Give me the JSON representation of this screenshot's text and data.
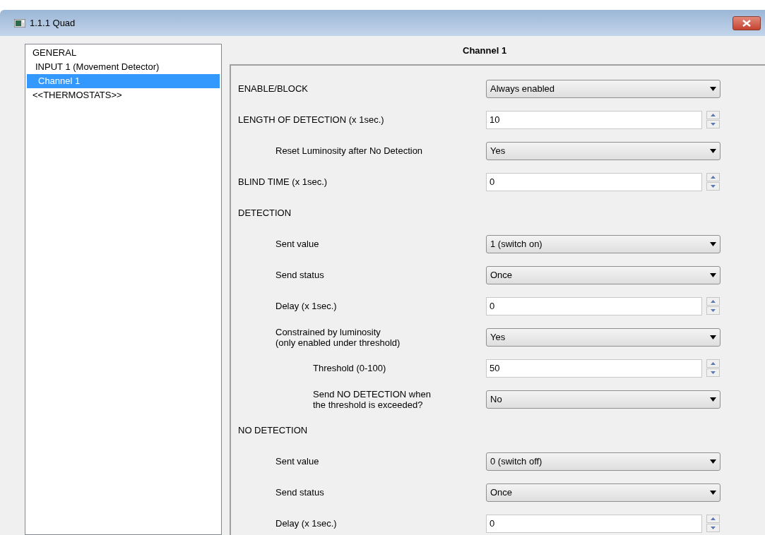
{
  "window": {
    "title": "1.1.1 Quad"
  },
  "sidebar": {
    "items": [
      {
        "label": "GENERAL",
        "selected": false,
        "children": [
          {
            "label": "INPUT 1 (Movement Detector)",
            "selected": false,
            "children": [
              {
                "label": "Channel 1",
                "selected": true
              }
            ]
          }
        ]
      },
      {
        "label": "<<THERMOSTATS>>",
        "selected": false
      }
    ]
  },
  "panel": {
    "title": "Channel 1",
    "rows": [
      {
        "kind": "select",
        "label": "ENABLE/BLOCK",
        "value": "Always enabled"
      },
      {
        "kind": "spin",
        "label": "LENGTH OF DETECTION (x 1sec.)",
        "value": "10",
        "children": [
          {
            "kind": "select",
            "label": "Reset Luminosity after No Detection",
            "value": "Yes"
          }
        ]
      },
      {
        "kind": "spin",
        "label": "BLIND TIME (x 1sec.)",
        "value": "0"
      },
      {
        "kind": "header",
        "label": "DETECTION",
        "children": [
          {
            "kind": "select",
            "label": "Sent value",
            "value": "1 (switch on)"
          },
          {
            "kind": "select",
            "label": "Send status",
            "value": "Once"
          },
          {
            "kind": "spin",
            "label": "Delay (x 1sec.)",
            "value": "0"
          },
          {
            "kind": "select",
            "label": "Constrained by luminosity\n(only enabled under threshold)",
            "value": "Yes",
            "children": [
              {
                "kind": "spin",
                "label": "Threshold (0-100)",
                "value": "50"
              },
              {
                "kind": "select",
                "label": "Send NO DETECTION when\nthe threshold is exceeded?",
                "value": "No"
              }
            ]
          }
        ]
      },
      {
        "kind": "header",
        "label": "NO DETECTION",
        "children": [
          {
            "kind": "select",
            "label": "Sent value",
            "value": "0 (switch off)"
          },
          {
            "kind": "select",
            "label": "Send status",
            "value": "Once"
          },
          {
            "kind": "spin",
            "label": "Delay (x 1sec.)",
            "value": "0"
          }
        ]
      }
    ]
  }
}
